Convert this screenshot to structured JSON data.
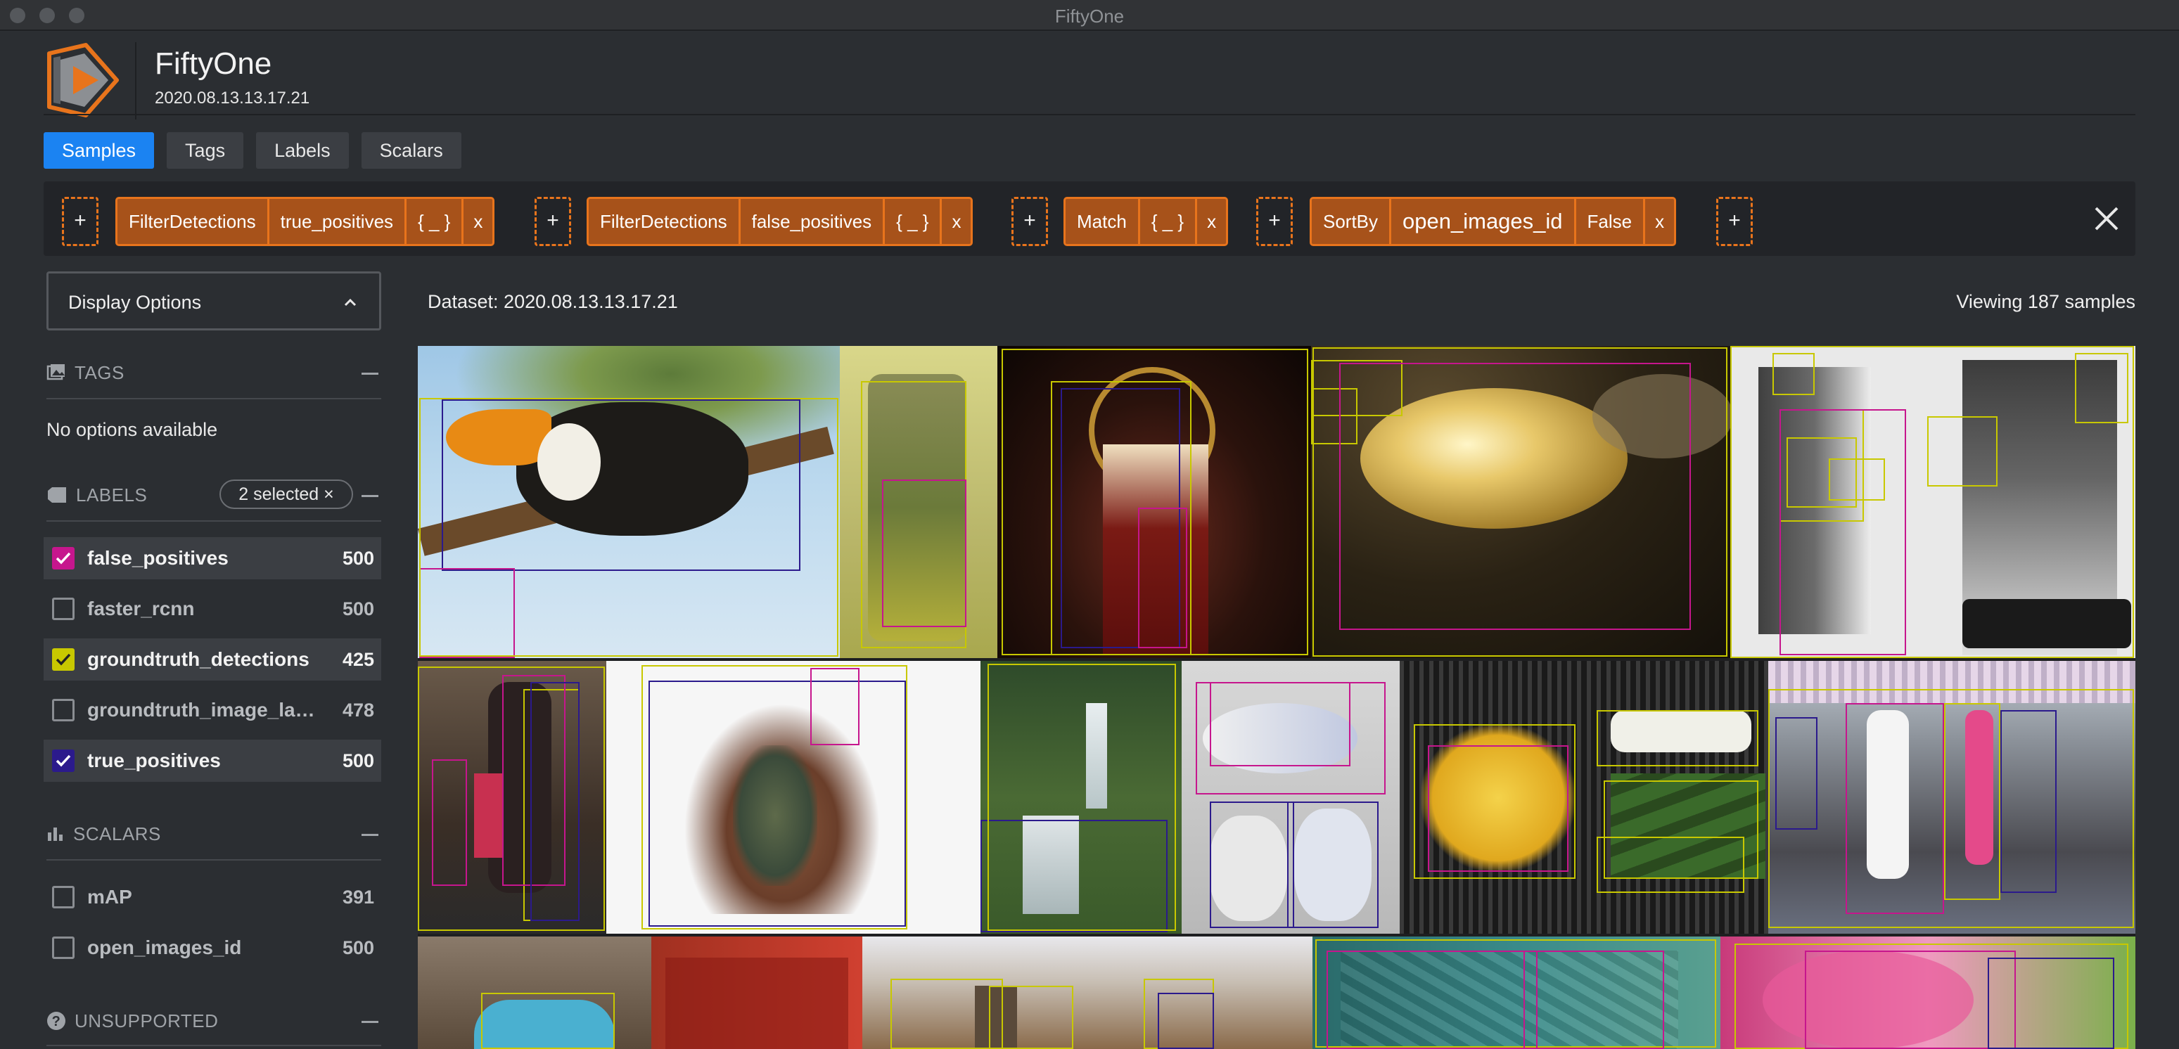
{
  "window": {
    "title": "FiftyOne"
  },
  "header": {
    "app_name": "FiftyOne",
    "dataset_name": "2020.08.13.13.17.21"
  },
  "tabs": [
    {
      "label": "Samples",
      "active": true
    },
    {
      "label": "Tags",
      "active": false
    },
    {
      "label": "Labels",
      "active": false
    },
    {
      "label": "Scalars",
      "active": false
    }
  ],
  "view_bar": {
    "add_label": "+",
    "stages": [
      {
        "name": "FilterDetections",
        "field": "true_positives",
        "params": "{ _ }",
        "remove": "x"
      },
      {
        "name": "FilterDetections",
        "field": "false_positives",
        "params": "{ _ }",
        "remove": "x"
      },
      {
        "name": "Match",
        "params": "{ _ }",
        "remove": "x"
      },
      {
        "name": "SortBy",
        "field": "open_images_id",
        "value": "False",
        "remove": "x"
      }
    ]
  },
  "sidebar": {
    "display_options": "Display Options",
    "tags": {
      "title": "TAGS",
      "empty": "No options available"
    },
    "labels": {
      "title": "LABELS",
      "selected_pill": "2 selected ×",
      "items": [
        {
          "label": "false_positives",
          "count": "500",
          "checked": true,
          "color": "#c6168d"
        },
        {
          "label": "faster_rcnn",
          "count": "500",
          "checked": false,
          "color": ""
        },
        {
          "label": "groundtruth_detections",
          "count": "425",
          "checked": true,
          "color": "#c8c800"
        },
        {
          "label": "groundtruth_image_labels",
          "count": "478",
          "checked": false,
          "color": ""
        },
        {
          "label": "true_positives",
          "count": "500",
          "checked": true,
          "color": "#2b1a8c"
        }
      ]
    },
    "scalars": {
      "title": "SCALARS",
      "items": [
        {
          "label": "mAP",
          "count": "391",
          "checked": false
        },
        {
          "label": "open_images_id",
          "count": "500",
          "checked": false
        }
      ]
    },
    "unsupported": {
      "title": "UNSUPPORTED"
    }
  },
  "main": {
    "dataset_label": "Dataset: 2020.08.13.13.17.21",
    "viewing": "Viewing 187 samples"
  },
  "colors": {
    "accent": "#1b83f2",
    "stage_border": "#e8741c",
    "stage_fill": "#a7521a",
    "gt_box": "#c8c800",
    "fp_box": "#c6168d",
    "tp_box": "#2b1a8c"
  }
}
